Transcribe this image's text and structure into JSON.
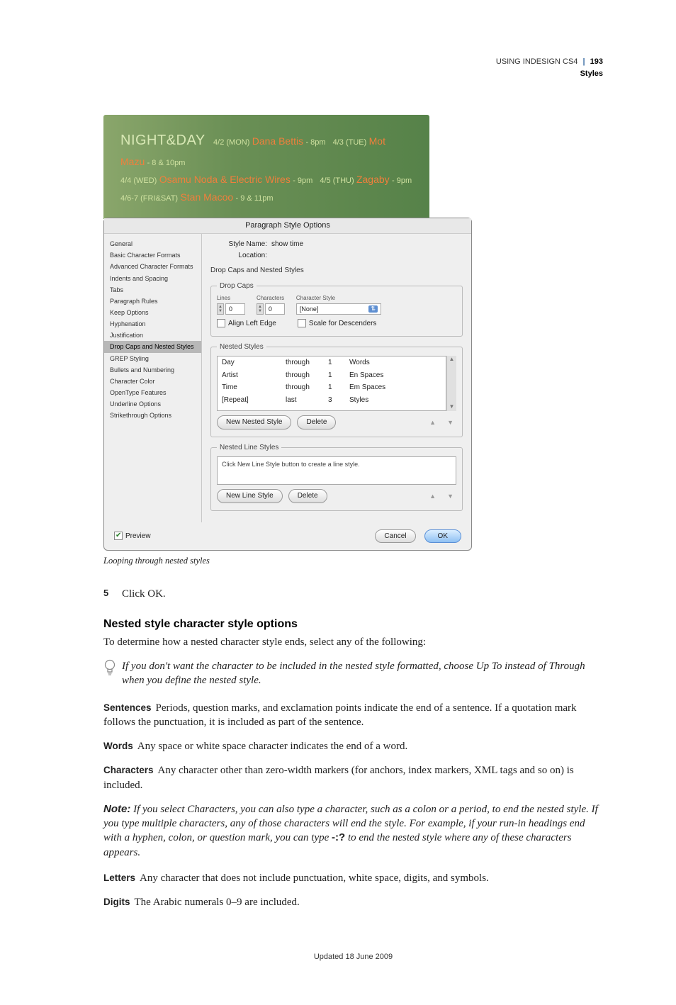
{
  "header": {
    "doc_title": "USING INDESIGN CS4",
    "page_num": "193",
    "section": "Styles"
  },
  "banner": {
    "venue": "NIGHT&DAY",
    "e1_date": "4/2 (MON)",
    "e1_artist": "Dana Bettis",
    "e1_time": "- 8pm",
    "e2_date": "4/3 (TUE)",
    "e2_artist": "Mot Mazu",
    "e2_time": "- 8 & 10pm",
    "e3_date": "4/4 (WED)",
    "e3_artist": "Osamu Noda & Electric Wires",
    "e3_time": "- 9pm",
    "e4_date": "4/5 (THU)",
    "e4_artist": "Zagaby",
    "e4_time": "- 9pm",
    "e5_date": "4/6-7 (FRI&SAT)",
    "e5_artist": "Stan Macoo",
    "e5_time": "- 9 & 11pm"
  },
  "dialog": {
    "title": "Paragraph Style Options",
    "style_name_label": "Style Name:",
    "style_name_value": "show time",
    "location_label": "Location:",
    "section_title": "Drop Caps and Nested Styles",
    "sidebar": {
      "i0": "General",
      "i1": "Basic Character Formats",
      "i2": "Advanced Character Formats",
      "i3": "Indents and Spacing",
      "i4": "Tabs",
      "i5": "Paragraph Rules",
      "i6": "Keep Options",
      "i7": "Hyphenation",
      "i8": "Justification",
      "i9": "Drop Caps and Nested Styles",
      "i10": "GREP Styling",
      "i11": "Bullets and Numbering",
      "i12": "Character Color",
      "i13": "OpenType Features",
      "i14": "Underline Options",
      "i15": "Strikethrough Options"
    },
    "dropcaps": {
      "legend": "Drop Caps",
      "lines_label": "Lines",
      "lines_value": "0",
      "chars_label": "Characters",
      "chars_value": "0",
      "style_label": "Character Style",
      "style_value": "[None]",
      "align_left": "Align Left Edge",
      "scale_desc": "Scale for Descenders"
    },
    "nested": {
      "legend": "Nested Styles",
      "r0": {
        "c0": "Day",
        "c1": "through",
        "c2": "1",
        "c3": "Words"
      },
      "r1": {
        "c0": "Artist",
        "c1": "through",
        "c2": "1",
        "c3": "En Spaces"
      },
      "r2": {
        "c0": "Time",
        "c1": "through",
        "c2": "1",
        "c3": "Em Spaces"
      },
      "r3": {
        "c0": "[Repeat]",
        "c1": "last",
        "c2": "3",
        "c3": "Styles"
      },
      "new_btn": "New Nested Style",
      "delete_btn": "Delete"
    },
    "linestyles": {
      "legend": "Nested Line Styles",
      "hint": "Click New Line Style button to create a line style.",
      "new_btn": "New Line Style",
      "delete_btn": "Delete"
    },
    "footer": {
      "preview": "Preview",
      "cancel": "Cancel",
      "ok": "OK"
    }
  },
  "caption": "Looping through nested styles",
  "step5": {
    "num": "5",
    "text": "Click OK."
  },
  "heading": "Nested style character style options",
  "intro": "To determine how a nested character style ends, select any of the following:",
  "tip": "If you don't want the character to be included in the nested style formatted, choose Up To instead of Through when you define the nested style.",
  "defs": {
    "sentences": {
      "term": "Sentences",
      "text": "Periods, question marks, and exclamation points indicate the end of a sentence. If a quotation mark follows the punctuation, it is included as part of the sentence."
    },
    "words": {
      "term": "Words",
      "text": "Any space or white space character indicates the end of a word."
    },
    "characters": {
      "term": "Characters",
      "text": "Any character other than zero-width markers (for anchors, index markers, XML tags and so on) is included."
    }
  },
  "note": {
    "label": "Note:",
    "text_a": "If you select Characters, you can also type a character, such as a colon or a period, to end the nested style. If you type multiple characters, any of those characters will end the style. For example, if your run-in headings end with a hyphen, colon, or question mark, you can type ",
    "punct": "-:?",
    "text_b": " to end the nested style where any of these characters appears."
  },
  "defs2": {
    "letters": {
      "term": "Letters",
      "text": "Any character that does not include punctuation, white space, digits, and symbols."
    },
    "digits": {
      "term": "Digits",
      "text": "The Arabic numerals 0–9 are included."
    }
  },
  "footer": "Updated 18 June 2009"
}
